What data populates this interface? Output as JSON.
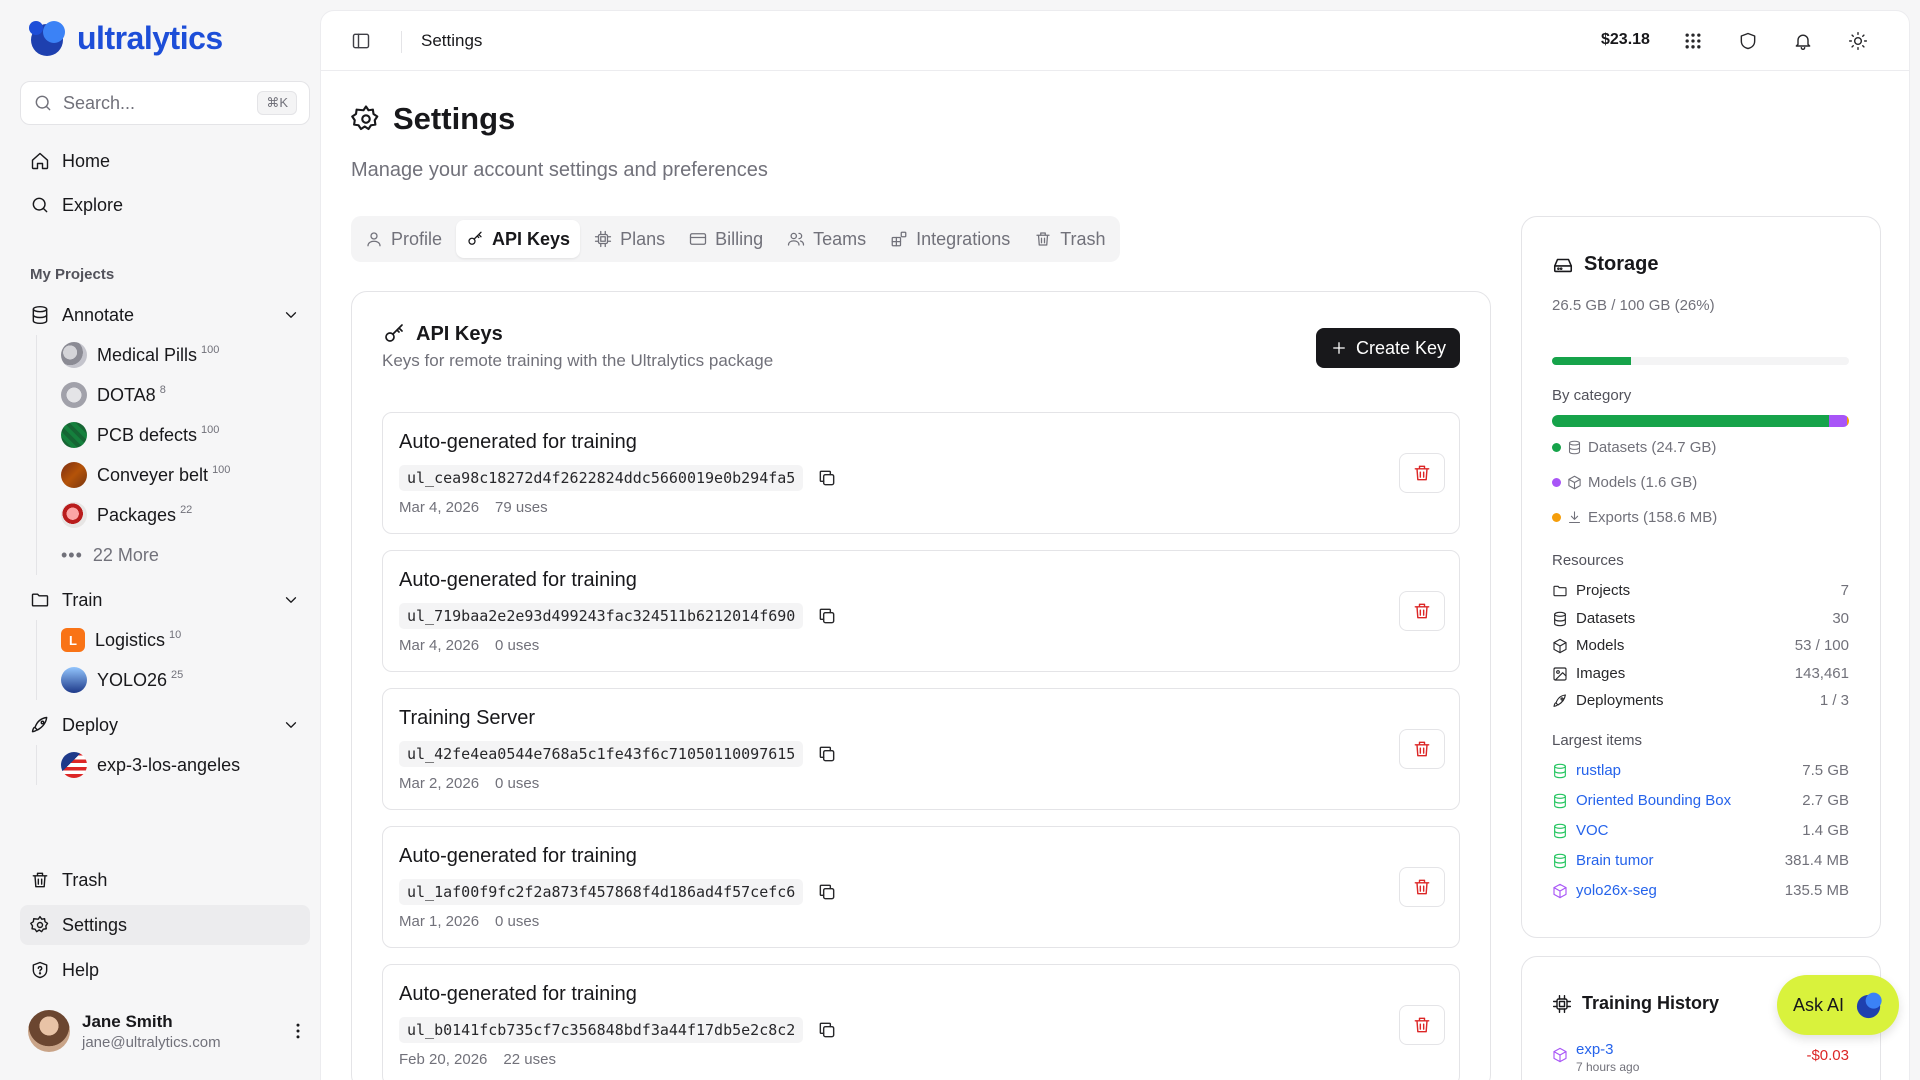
{
  "brand": {
    "name": "ultralytics"
  },
  "search": {
    "placeholder": "Search...",
    "shortcut": "⌘K"
  },
  "nav": {
    "home": "Home",
    "explore": "Explore",
    "trash": "Trash",
    "settings": "Settings",
    "help": "Help"
  },
  "projects": {
    "label": "My Projects",
    "annotate": {
      "label": "Annotate",
      "items": [
        {
          "name": "Medical Pills",
          "count": "100"
        },
        {
          "name": "DOTA8",
          "count": "8"
        },
        {
          "name": "PCB defects",
          "count": "100"
        },
        {
          "name": "Conveyer belt",
          "count": "100"
        },
        {
          "name": "Packages",
          "count": "22"
        }
      ],
      "more": "22 More"
    },
    "train": {
      "label": "Train",
      "items": [
        {
          "name": "Logistics",
          "count": "10",
          "initial": "L"
        },
        {
          "name": "YOLO26",
          "count": "25"
        }
      ]
    },
    "deploy": {
      "label": "Deploy",
      "items": [
        {
          "name": "exp-3-los-angeles"
        }
      ]
    }
  },
  "user": {
    "name": "Jane Smith",
    "email": "jane@ultralytics.com"
  },
  "topbar": {
    "breadcrumb": "Settings",
    "credit": "$23.18"
  },
  "page": {
    "title": "Settings",
    "subtitle": "Manage your account settings and preferences"
  },
  "tabs": [
    "Profile",
    "API Keys",
    "Plans",
    "Billing",
    "Teams",
    "Integrations",
    "Trash"
  ],
  "apiKeys": {
    "title": "API Keys",
    "subtitle": "Keys for remote training with the Ultralytics package",
    "create_label": "Create Key",
    "keys": [
      {
        "name": "Auto-generated for training",
        "value": "ul_cea98c18272d4f2622824ddc5660019e0b294fa5",
        "date": "Mar 4, 2026",
        "uses": "79 uses"
      },
      {
        "name": "Auto-generated for training",
        "value": "ul_719baa2e2e93d499243fac324511b6212014f690",
        "date": "Mar 4, 2026",
        "uses": "0 uses"
      },
      {
        "name": "Training Server",
        "value": "ul_42fe4ea0544e768a5c1fe43f6c71050110097615",
        "date": "Mar 2, 2026",
        "uses": "0 uses"
      },
      {
        "name": "Auto-generated for training",
        "value": "ul_1af00f9fc2f2a873f457868f4d186ad4f57cefc6",
        "date": "Mar 1, 2026",
        "uses": "0 uses"
      },
      {
        "name": "Auto-generated for training",
        "value": "ul_b0141fcb735cf7c356848bdf3a44f17db5e2c8c2",
        "date": "Feb 20, 2026",
        "uses": "22 uses"
      }
    ]
  },
  "storage": {
    "title": "Storage",
    "summary": "26.5 GB / 100 GB (26%)",
    "used_fraction": 0.265,
    "by_category_label": "By category",
    "categories": [
      {
        "label": "Datasets (24.7 GB)",
        "color": "#16a34a",
        "gb": 24.7
      },
      {
        "label": "Models (1.6 GB)",
        "color": "#a855f7",
        "gb": 1.6
      },
      {
        "label": "Exports (158.6 MB)",
        "color": "#f59e0b",
        "gb": 0.1586
      }
    ],
    "resources_label": "Resources",
    "resources": [
      {
        "label": "Projects",
        "value": "7"
      },
      {
        "label": "Datasets",
        "value": "30"
      },
      {
        "label": "Models",
        "value": "53 / 100"
      },
      {
        "label": "Images",
        "value": "143,461"
      },
      {
        "label": "Deployments",
        "value": "1 / 3"
      }
    ],
    "largest_label": "Largest items",
    "largest": [
      {
        "name": "rustlap",
        "size": "7.5 GB",
        "kind": "dataset"
      },
      {
        "name": "Oriented Bounding Box",
        "size": "2.7 GB",
        "kind": "dataset"
      },
      {
        "name": "VOC",
        "size": "1.4 GB",
        "kind": "dataset"
      },
      {
        "name": "Brain tumor",
        "size": "381.4 MB",
        "kind": "dataset"
      },
      {
        "name": "yolo26x-seg",
        "size": "135.5 MB",
        "kind": "model"
      }
    ]
  },
  "history": {
    "title": "Training History",
    "items": [
      {
        "name": "exp-3",
        "time": "7 hours ago",
        "cost": "-$0.03"
      }
    ]
  },
  "askai": {
    "label": "Ask AI"
  }
}
